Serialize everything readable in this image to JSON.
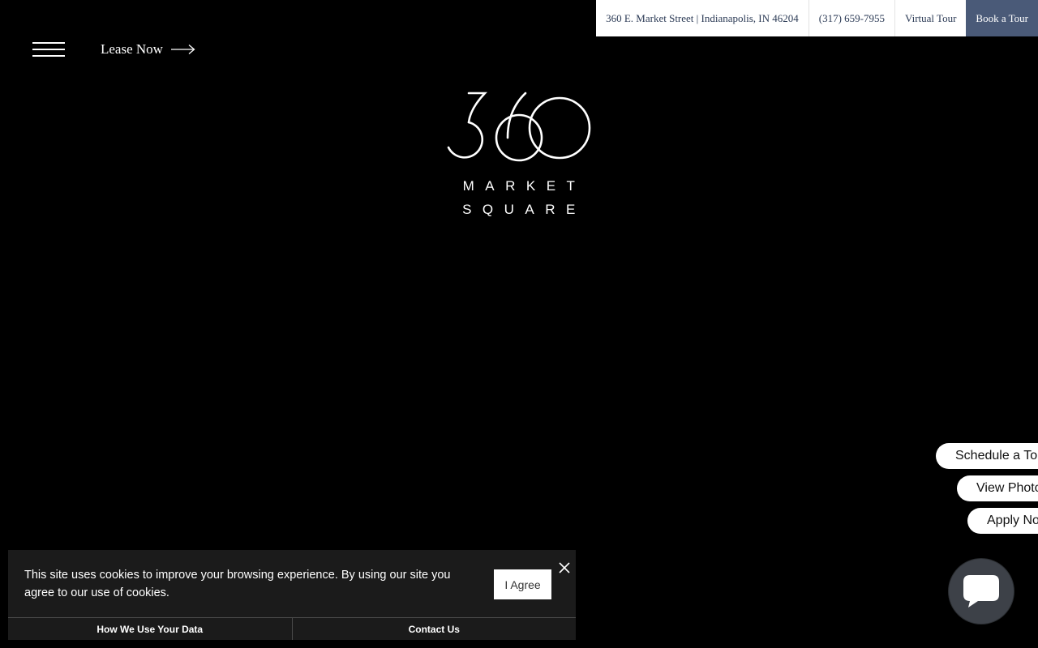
{
  "topbar": {
    "address": "360 E. Market Street | Indianapolis, IN 46204",
    "phone": "(317) 659-7955",
    "virtual_tour": "Virtual Tour",
    "book_tour": "Book a Tour"
  },
  "nav": {
    "lease_now": "Lease Now",
    "menu_icon": "hamburger-menu-icon",
    "arrow_icon": "arrow-right-icon"
  },
  "logo": {
    "number": "360",
    "word1": "MARKET",
    "word2": "SQUARE"
  },
  "side_actions": [
    {
      "label": "Schedule a To"
    },
    {
      "label": "View Photo"
    },
    {
      "label": "Apply No"
    }
  ],
  "chat": {
    "icon": "chat-bubble-icon"
  },
  "cookie_banner": {
    "message": "This site uses cookies to improve your browsing experience. By using our site you agree to our use of cookies.",
    "agree_label": "I Agree",
    "links": [
      {
        "label": "How We Use Your Data"
      },
      {
        "label": "Contact Us"
      }
    ]
  },
  "colors": {
    "background": "#000000",
    "book_tour_bg": "#4a5a78",
    "topbar_text": "#2b3a55",
    "cookie_bg": "#1b1b1b"
  }
}
